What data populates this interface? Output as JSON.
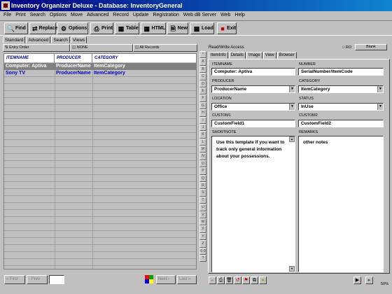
{
  "window": {
    "title": "Inventory Organizer Deluxe - Database: InventoryGeneral"
  },
  "menu": [
    "File",
    "Print",
    "Search",
    "Options",
    "Move",
    "Advanced",
    "Record",
    "Update",
    "Registration",
    "Web dB Server",
    "Web",
    "Help"
  ],
  "toolbar": {
    "find": "Find",
    "replace": "Replace",
    "options": "Options",
    "print": "Print",
    "table": "Table",
    "html": "HTML",
    "new": "New",
    "load": "Load",
    "exit": "Exit"
  },
  "left_tabs": [
    "Standard",
    "Advanced",
    "Search",
    "Views"
  ],
  "filters": {
    "entry_order": "Entry Order",
    "none": "NONE",
    "all_records": "All Records"
  },
  "grid": {
    "columns": [
      "ITEMNAME",
      "PRODUCER",
      "CATEGORY"
    ],
    "rows": [
      {
        "itemname": "Computer: Aptiva",
        "producer": "ProducerName",
        "category": "ItemCategory"
      },
      {
        "itemname": "Sony TV",
        "producer": "ProducerName",
        "category": "ItemCategory"
      }
    ]
  },
  "nav": {
    "first": "First",
    "prev": "Prev",
    "next": "Next",
    "last": "Last"
  },
  "alphabet": [
    "*",
    "A",
    "B",
    "C",
    "D",
    "E",
    "F",
    "G",
    "H",
    "I",
    "J",
    "K",
    "L",
    "M",
    "N",
    "O",
    "P",
    "Q",
    "R",
    "S",
    "T",
    "U",
    "V",
    "W",
    "X",
    "Y",
    "Z",
    "0-9",
    "?"
  ],
  "right_panel": {
    "access": "Read/Write Access",
    "ro": "RO",
    "blank": "Blank",
    "tabs": [
      "ItemInfo",
      "Details",
      "Image",
      "View",
      "Browser"
    ],
    "fields": {
      "itemname": {
        "label": "ITEMNAME",
        "value": "Computer: Aptiva"
      },
      "number": {
        "label": "NUMBER",
        "value": "SerialNumber/ItemCode"
      },
      "producer": {
        "label": "PRODUCER",
        "value": "ProducerName"
      },
      "category": {
        "label": "CATEGORY",
        "value": "ItemCategory"
      },
      "location": {
        "label": "LOCATION",
        "value": "Office"
      },
      "status": {
        "label": "STATUS",
        "value": "InUse"
      },
      "custom1": {
        "label": "CUSTOM1",
        "value": "CustomField1"
      },
      "custom2": {
        "label": "CUSTOM2",
        "value": "CustomField2"
      },
      "shortnote": {
        "label": "SHORTNOTE",
        "value": "Use this template if you want to track only general information about your possessions."
      },
      "remarks": {
        "label": "REMARKS",
        "value": "other notes"
      }
    },
    "zoom": "50%"
  }
}
